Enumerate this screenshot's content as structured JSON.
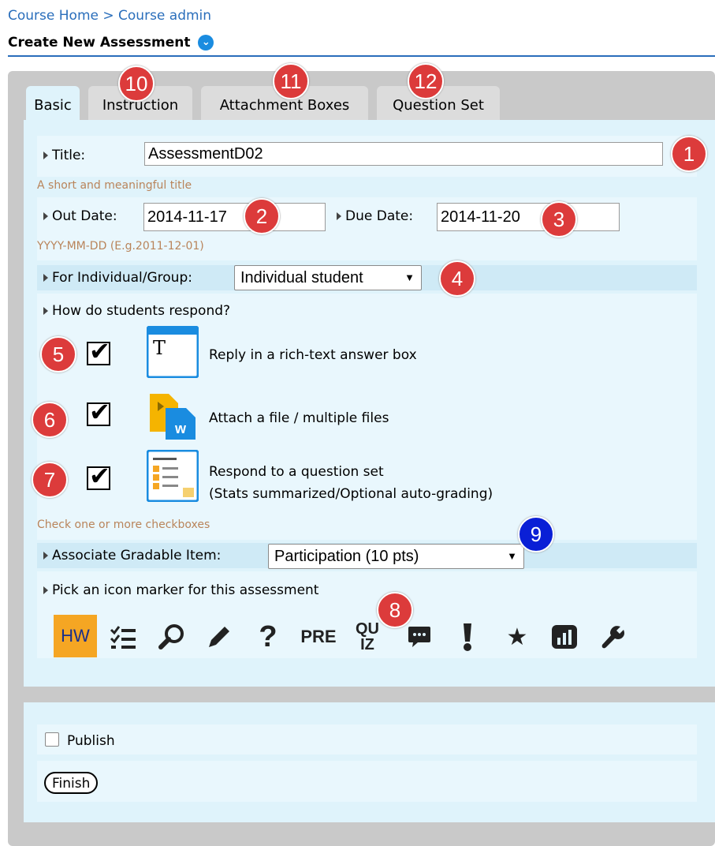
{
  "breadcrumb": {
    "home": "Course Home",
    "sep": " > ",
    "admin": "Course admin"
  },
  "page_title": "Create New Assessment",
  "tabs": [
    {
      "label": "Basic",
      "active": true
    },
    {
      "label": "Instruction"
    },
    {
      "label": "Attachment Boxes"
    },
    {
      "label": "Question Set"
    }
  ],
  "form": {
    "title_label": "Title:",
    "title_value": "AssessmentD02",
    "title_hint": "A short and meaningful title",
    "out_date_label": "Out Date:",
    "out_date_value": "2014-11-17",
    "due_date_label": "Due Date:",
    "due_date_value": "2014-11-20",
    "date_hint": "YYYY-MM-DD (E.g.2011-12-01)",
    "group_label": "For Individual/Group:",
    "group_value": "Individual student",
    "respond_label": "How do students respond?",
    "options": [
      {
        "text": "Reply in a rich-text answer box",
        "checked": true,
        "icon": "rich-text-icon"
      },
      {
        "text": "Attach a file / multiple files",
        "checked": true,
        "icon": "file-attach-icon"
      },
      {
        "text": "Respond to a question set",
        "text2": "(Stats summarized/Optional auto-grading)",
        "checked": true,
        "icon": "question-set-icon"
      }
    ],
    "checkbox_hint": "Check one or more checkboxes",
    "gradable_label": "Associate Gradable Item:",
    "gradable_value": "Participation (10 pts)",
    "icon_label": "Pick an icon marker for this assessment",
    "markers": [
      "HW",
      "checklist-icon",
      "search-icon",
      "pencil-icon",
      "question-icon",
      "PRE",
      "QUIZ",
      "comment-icon",
      "exclamation-icon",
      "star-icon",
      "chart-icon",
      "wrench-icon"
    ],
    "marker_pre": "PRE",
    "marker_quiz_top": "QU",
    "marker_quiz_bottom": "IZ"
  },
  "publish_label": "Publish",
  "finish_label": "Finish",
  "badges": {
    "b1": "1",
    "b2": "2",
    "b3": "3",
    "b4": "4",
    "b5": "5",
    "b6": "6",
    "b7": "7",
    "b8": "8",
    "b9": "9",
    "b10": "10",
    "b11": "11",
    "b12": "12"
  },
  "colors": {
    "link": "#2a6ebb",
    "panel": "#dff3fb",
    "badge_red": "#dc3b3b",
    "badge_blue": "#0a1fd6",
    "hw_orange": "#f5a623"
  }
}
